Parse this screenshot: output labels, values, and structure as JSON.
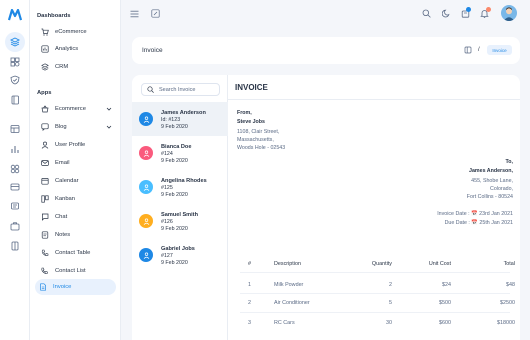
{
  "sidebar": {
    "dashboards_heading": "Dashboards",
    "dashboards": [
      {
        "label": "eCommerce",
        "icon": "shopping-cart-icon"
      },
      {
        "label": "Analytics",
        "icon": "chart-icon"
      },
      {
        "label": "CRM",
        "icon": "layers-icon"
      }
    ],
    "apps_heading": "Apps",
    "apps": [
      {
        "label": "Ecommerce",
        "icon": "basket-icon",
        "expandable": true
      },
      {
        "label": "Blog",
        "icon": "chat-bubble-icon",
        "expandable": true
      },
      {
        "label": "User Profile",
        "icon": "user-icon"
      },
      {
        "label": "Email",
        "icon": "mail-icon"
      },
      {
        "label": "Calendar",
        "icon": "calendar-icon"
      },
      {
        "label": "Kanban",
        "icon": "kanban-icon"
      },
      {
        "label": "Chat",
        "icon": "message-icon"
      },
      {
        "label": "Notes",
        "icon": "note-icon"
      },
      {
        "label": "Contact Table",
        "icon": "phone-icon"
      },
      {
        "label": "Contact List",
        "icon": "list-phone-icon"
      },
      {
        "label": "Invoice",
        "icon": "file-text-icon",
        "active": true
      }
    ]
  },
  "topbar": {
    "badge_colors": {
      "cart": "#1e88e5",
      "notifications": "#fa896b"
    }
  },
  "breadcrumb": {
    "title": "Invoice",
    "separator": "/",
    "current": "Invoice"
  },
  "invoice_list": {
    "search_placeholder": "Search Invoice",
    "entries": [
      {
        "name": "James Anderson",
        "id": "Id: #123",
        "date": "9 Feb 2020",
        "color": "#1e88e5",
        "selected": true
      },
      {
        "name": "Bianca Doe",
        "id": "#124",
        "date": "9 Feb 2020",
        "color": "#fa5a7d"
      },
      {
        "name": "Angelina Rhodes",
        "id": "#125",
        "date": "9 Feb 2020",
        "color": "#49beff"
      },
      {
        "name": "Samuel Smith",
        "id": "#126",
        "date": "9 Feb 2020",
        "color": "#ffae1f"
      },
      {
        "name": "Gabriel Jobs",
        "id": "#127",
        "date": "9 Feb 2020",
        "color": "#1e88e5"
      }
    ]
  },
  "invoice": {
    "heading": "INVOICE",
    "from_label": "From,",
    "from_name": "Steve Jobs",
    "from_address": [
      "1108, Clair Street,",
      "Massachusetts,",
      "Woods Hole - 02543"
    ],
    "to_label": "To,",
    "to_name": "James Anderson,",
    "to_address": [
      "455, Shobe Lane,",
      "Colorado,",
      "Fort Collins - 80524"
    ],
    "invoice_date": "Invoice Date : 📅 23rd Jan 2021",
    "due_date": "Due Date : 📅 25th Jan 2021",
    "columns": [
      "#",
      "Description",
      "Quantity",
      "Unit Cost",
      "Total"
    ],
    "items": [
      {
        "num": "1",
        "desc": "Milk Powder",
        "qty": "2",
        "unit": "$24",
        "total": "$48"
      },
      {
        "num": "2",
        "desc": "Air Conditioner",
        "qty": "5",
        "unit": "$500",
        "total": "$2500"
      },
      {
        "num": "3",
        "desc": "RC Cars",
        "qty": "30",
        "unit": "$600",
        "total": "$18000"
      }
    ]
  }
}
